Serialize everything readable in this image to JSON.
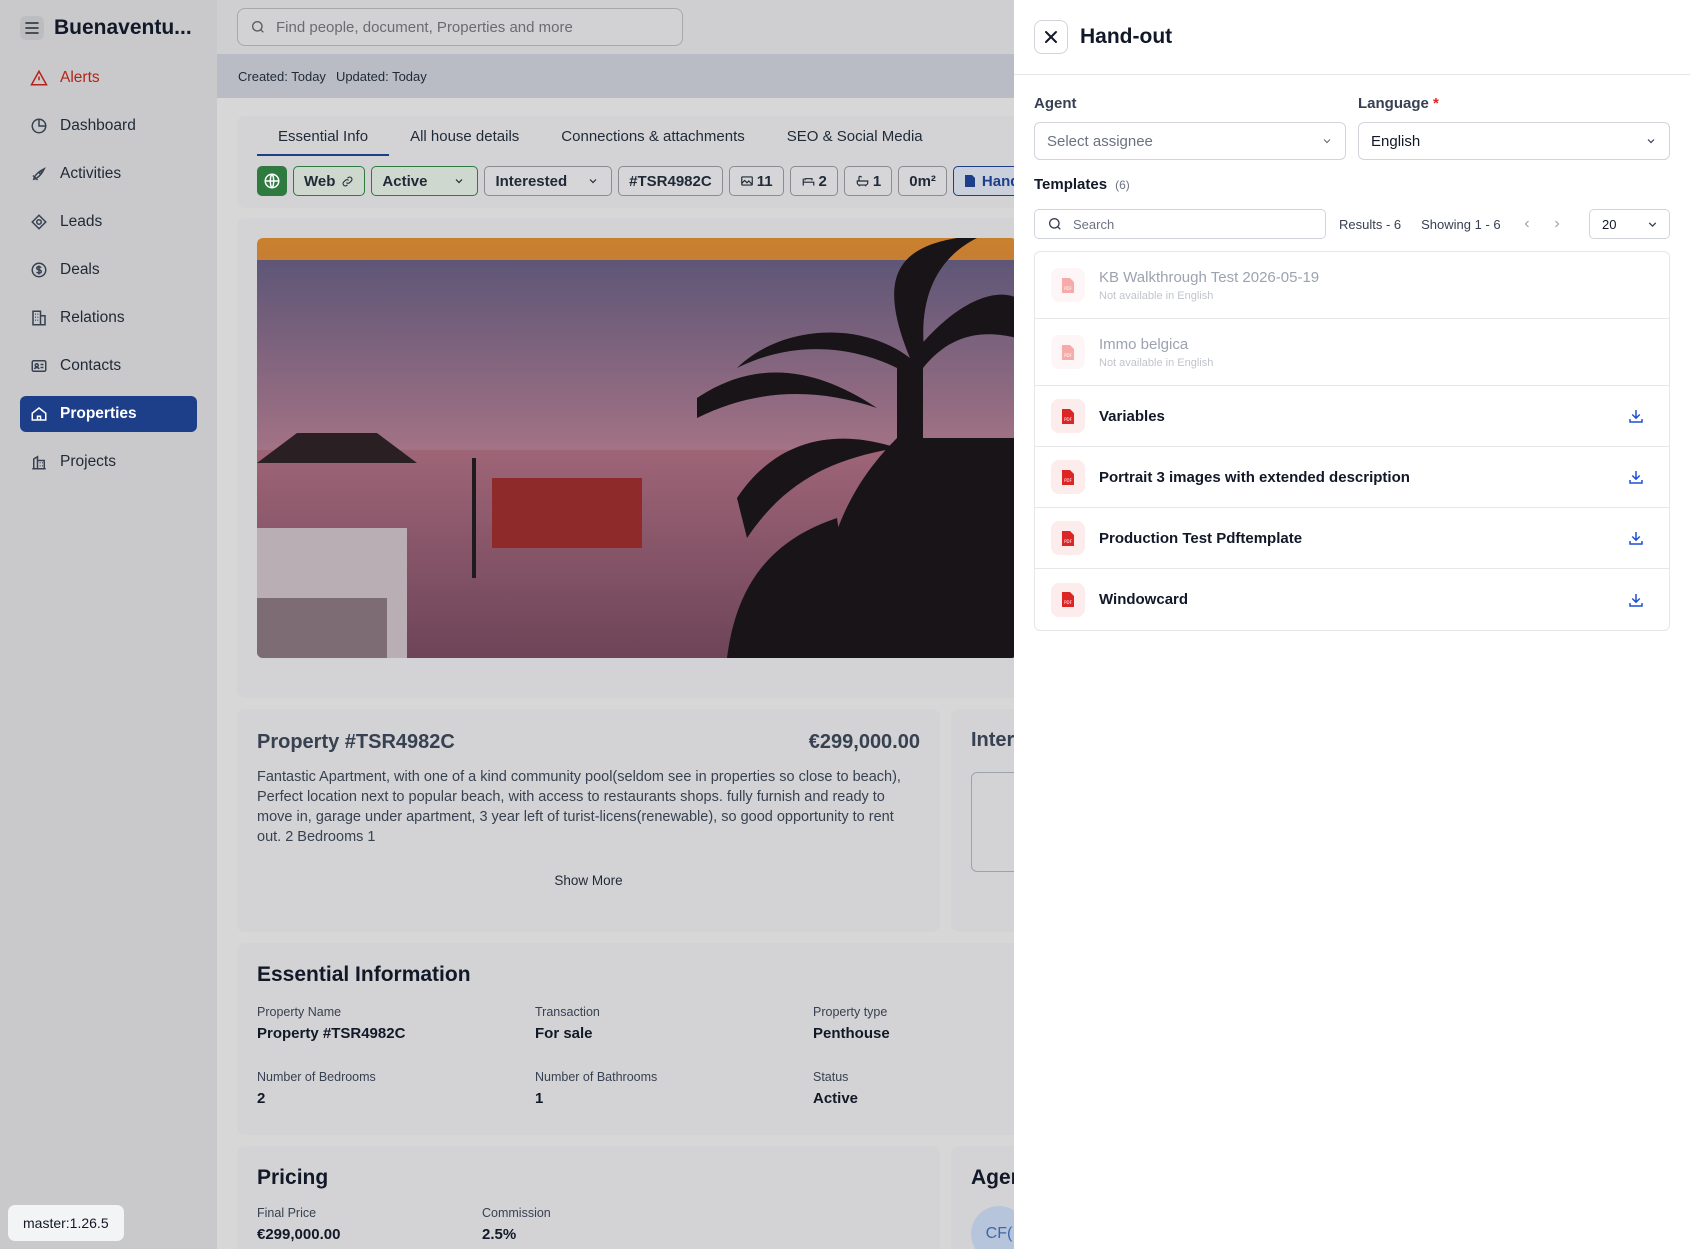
{
  "app": {
    "brand": "Buenaventu...",
    "version": "master:1.26.5"
  },
  "sidebar": {
    "items": [
      {
        "label": "Alerts",
        "icon": "alert-triangle-icon"
      },
      {
        "label": "Dashboard",
        "icon": "pie-chart-icon"
      },
      {
        "label": "Activities",
        "icon": "rocket-icon"
      },
      {
        "label": "Leads",
        "icon": "target-icon"
      },
      {
        "label": "Deals",
        "icon": "dollar-circle-icon"
      },
      {
        "label": "Relations",
        "icon": "building-icon"
      },
      {
        "label": "Contacts",
        "icon": "id-card-icon"
      },
      {
        "label": "Properties",
        "icon": "home-icon"
      },
      {
        "label": "Projects",
        "icon": "buildings-icon"
      }
    ],
    "active": "Properties"
  },
  "search": {
    "placeholder": "Find people, document, Properties and more"
  },
  "meta": {
    "created": "Created: Today",
    "updated": "Updated: Today"
  },
  "tabs": [
    "Essential Info",
    "All house details",
    "Connections & attachments",
    "SEO & Social Media"
  ],
  "chips": {
    "web": "Web",
    "status": "Active",
    "interest": "Interested",
    "ref": "#TSR4982C",
    "images": "11",
    "bedrooms": "2",
    "bathrooms": "1",
    "area": "0m²",
    "handout": "Hand-out"
  },
  "property": {
    "title": "Property #TSR4982C",
    "price": "€299,000.00",
    "description": "Fantastic Apartment, with one of a kind community pool(seldom see in properties so close to beach),  Perfect location next to popular beach, with access to restaurants shops. fully furnish and ready to move in, garage under apartment, 3 year left of turist-licens(renewable), so good opportunity to rent out. 2 Bedrooms 1",
    "show_more": "Show More"
  },
  "interested": {
    "title": "Inter"
  },
  "essential": {
    "title": "Essential Information",
    "fields": [
      {
        "label": "Property Name",
        "value": "Property #TSR4982C"
      },
      {
        "label": "Transaction",
        "value": "For sale"
      },
      {
        "label": "Property type",
        "value": "Penthouse"
      },
      {
        "label": "Number of Bedrooms",
        "value": "2"
      },
      {
        "label": "Number of Bathrooms",
        "value": "1"
      },
      {
        "label": "Status",
        "value": "Active"
      }
    ]
  },
  "pricing": {
    "title": "Pricing",
    "fields": [
      {
        "label": "Final Price",
        "value": "€299,000.00"
      },
      {
        "label": "Commission",
        "value": "2.5%"
      }
    ]
  },
  "agent_card": {
    "title": "Agen",
    "initials": "CF("
  },
  "drawer": {
    "title": "Hand-out",
    "agent_label": "Agent",
    "agent_placeholder": "Select assignee",
    "language_label": "Language",
    "language_required": "*",
    "language_value": "English",
    "templates_label": "Templates",
    "templates_count": "(6)",
    "search_placeholder": "Search",
    "results": "Results - 6",
    "showing": "Showing 1 - 6",
    "per_page": "20",
    "templates": [
      {
        "name": "KB Walkthrough Test 2026-05-19",
        "note": "Not available in English",
        "available": false
      },
      {
        "name": "Immo belgica",
        "note": "Not available in English",
        "available": false
      },
      {
        "name": "Variables",
        "available": true
      },
      {
        "name": "Portrait 3 images with extended description",
        "available": true
      },
      {
        "name": "Production Test Pdftemplate",
        "available": true
      },
      {
        "name": "Windowcard",
        "available": true
      }
    ]
  },
  "colors": {
    "accent": "#1d3f8a",
    "alert": "#b42318",
    "pdf": "#dc2626",
    "active_green": "#2f7a3f"
  }
}
